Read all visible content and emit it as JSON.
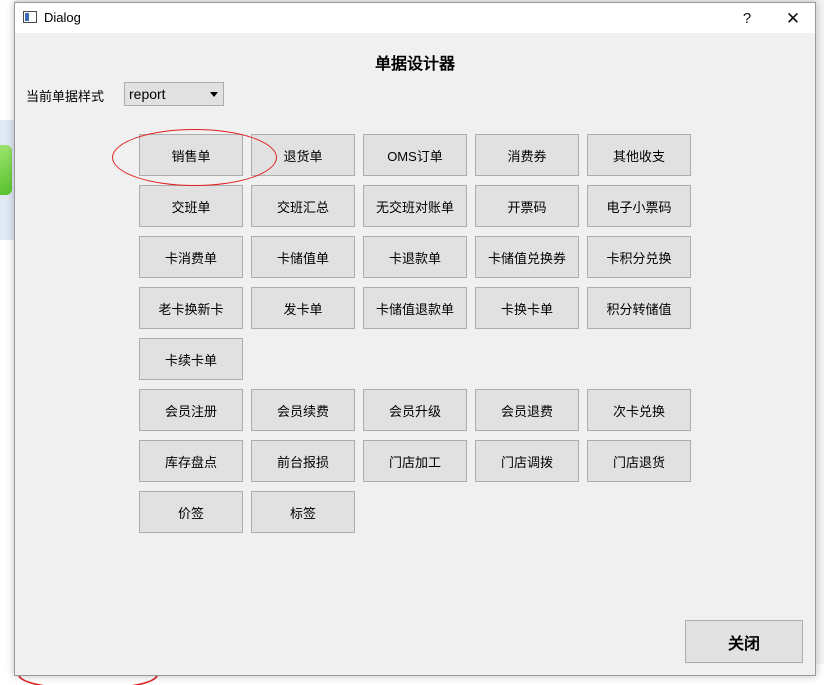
{
  "window": {
    "title": "Dialog",
    "help_label": "?",
    "close_label": "✕"
  },
  "designer": {
    "title": "单据设计器",
    "style_label": "当前单据样式",
    "style_value": "report"
  },
  "buttons": {
    "row1": [
      "销售单",
      "退货单",
      "OMS订单",
      "消费券",
      "其他收支"
    ],
    "row2": [
      "交班单",
      "交班汇总",
      "无交班对账单",
      "开票码",
      "电子小票码"
    ],
    "row3": [
      "卡消费单",
      "卡储值单",
      "卡退款单",
      "卡储值兑换券",
      "卡积分兑换"
    ],
    "row4": [
      "老卡换新卡",
      "发卡单",
      "卡储值退款单",
      "卡换卡单",
      "积分转储值"
    ],
    "row5": [
      "卡续卡单"
    ],
    "row6": [
      "会员注册",
      "会员续费",
      "会员升级",
      "会员退费",
      "次卡兑换"
    ],
    "row7": [
      "库存盘点",
      "前台报损",
      "门店加工",
      "门店调拨",
      "门店退货"
    ],
    "row8": [
      "价签",
      "标签"
    ]
  },
  "footer": {
    "close_label": "关闭"
  },
  "colors": {
    "highlight": "#e0201f",
    "button_bg": "#e1e1e1",
    "dialog_bg": "#f0f0f0"
  }
}
